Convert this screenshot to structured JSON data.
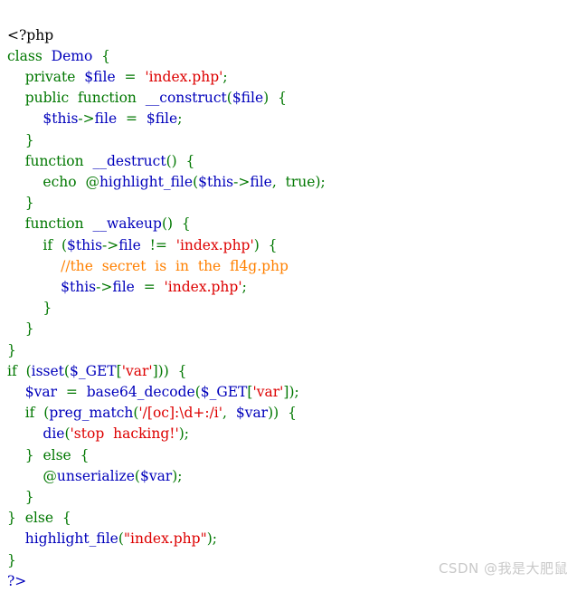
{
  "app": {
    "kind": "php-source-highlight",
    "background_color": "#ffffff"
  },
  "palette": {
    "html_tag": "#000000",
    "variable_or_function": "#0000BB",
    "keyword": "#007700",
    "string": "#DD0000",
    "comment": "#FF8000"
  },
  "watermark": {
    "text": "CSDN @我是大肥鼠",
    "color": "#c9c9c9"
  },
  "code": {
    "language": "php",
    "full_text": "<?php\nclass Demo  {\n    private  $file  =  'index.php';\n    public  function  __construct($file)  {\n        $this->file  =  $file;\n    }\n    function  __destruct()  {\n        echo  @highlight_file($this->file,  true);\n    }\n    function  __wakeup()  {\n        if  ($this->file  !=  'index.php')  {\n            //the  secret  is  in  the  fl4g.php\n            $this->file  =  'index.php';\n        }\n    }\n}\nif  (isset($_GET['var']))  {\n    $var  =  base64_decode($_GET['var']);\n    if  (preg_match('/[oc]:\\d+:/i',  $var))  {\n        die('stop  hacking!');\n    }  else  {\n        @unserialize($var);\n    }\n}  else  {\n    highlight_file(\"index.php\");\n}\n?>",
    "lines": [
      {
        "indent": 0,
        "tokens": [
          {
            "t": "html",
            "s": "<?php"
          }
        ]
      },
      {
        "indent": 0,
        "tokens": [
          {
            "t": "keyword",
            "s": "class"
          },
          {
            "t": "plain",
            "s": "  "
          },
          {
            "t": "default",
            "s": "Demo"
          },
          {
            "t": "plain",
            "s": "  "
          },
          {
            "t": "keyword",
            "s": "{"
          }
        ]
      },
      {
        "indent": 4,
        "tokens": [
          {
            "t": "keyword",
            "s": "private"
          },
          {
            "t": "plain",
            "s": "  "
          },
          {
            "t": "default",
            "s": "$file"
          },
          {
            "t": "plain",
            "s": "  "
          },
          {
            "t": "keyword",
            "s": "="
          },
          {
            "t": "plain",
            "s": "  "
          },
          {
            "t": "string",
            "s": "'index.php'"
          },
          {
            "t": "keyword",
            "s": ";"
          }
        ]
      },
      {
        "indent": 4,
        "tokens": [
          {
            "t": "keyword",
            "s": "public"
          },
          {
            "t": "plain",
            "s": "  "
          },
          {
            "t": "keyword",
            "s": "function"
          },
          {
            "t": "plain",
            "s": "  "
          },
          {
            "t": "default",
            "s": "__construct"
          },
          {
            "t": "keyword",
            "s": "("
          },
          {
            "t": "default",
            "s": "$file"
          },
          {
            "t": "keyword",
            "s": ")"
          },
          {
            "t": "plain",
            "s": "  "
          },
          {
            "t": "keyword",
            "s": "{"
          }
        ]
      },
      {
        "indent": 8,
        "tokens": [
          {
            "t": "default",
            "s": "$this"
          },
          {
            "t": "keyword",
            "s": "->"
          },
          {
            "t": "default",
            "s": "file"
          },
          {
            "t": "plain",
            "s": "  "
          },
          {
            "t": "keyword",
            "s": "="
          },
          {
            "t": "plain",
            "s": "  "
          },
          {
            "t": "default",
            "s": "$file"
          },
          {
            "t": "keyword",
            "s": ";"
          }
        ]
      },
      {
        "indent": 4,
        "tokens": [
          {
            "t": "keyword",
            "s": "}"
          }
        ]
      },
      {
        "indent": 4,
        "tokens": [
          {
            "t": "keyword",
            "s": "function"
          },
          {
            "t": "plain",
            "s": "  "
          },
          {
            "t": "default",
            "s": "__destruct"
          },
          {
            "t": "keyword",
            "s": "()"
          },
          {
            "t": "plain",
            "s": "  "
          },
          {
            "t": "keyword",
            "s": "{"
          }
        ]
      },
      {
        "indent": 8,
        "tokens": [
          {
            "t": "keyword",
            "s": "echo"
          },
          {
            "t": "plain",
            "s": "  "
          },
          {
            "t": "keyword",
            "s": "@"
          },
          {
            "t": "default",
            "s": "highlight_file"
          },
          {
            "t": "keyword",
            "s": "("
          },
          {
            "t": "default",
            "s": "$this"
          },
          {
            "t": "keyword",
            "s": "->"
          },
          {
            "t": "default",
            "s": "file"
          },
          {
            "t": "keyword",
            "s": ","
          },
          {
            "t": "plain",
            "s": "  "
          },
          {
            "t": "keyword",
            "s": "true"
          },
          {
            "t": "keyword",
            "s": ");"
          }
        ]
      },
      {
        "indent": 4,
        "tokens": [
          {
            "t": "keyword",
            "s": "}"
          }
        ]
      },
      {
        "indent": 4,
        "tokens": [
          {
            "t": "keyword",
            "s": "function"
          },
          {
            "t": "plain",
            "s": "  "
          },
          {
            "t": "default",
            "s": "__wakeup"
          },
          {
            "t": "keyword",
            "s": "()"
          },
          {
            "t": "plain",
            "s": "  "
          },
          {
            "t": "keyword",
            "s": "{"
          }
        ]
      },
      {
        "indent": 8,
        "tokens": [
          {
            "t": "keyword",
            "s": "if"
          },
          {
            "t": "plain",
            "s": "  "
          },
          {
            "t": "keyword",
            "s": "("
          },
          {
            "t": "default",
            "s": "$this"
          },
          {
            "t": "keyword",
            "s": "->"
          },
          {
            "t": "default",
            "s": "file"
          },
          {
            "t": "plain",
            "s": "  "
          },
          {
            "t": "keyword",
            "s": "!="
          },
          {
            "t": "plain",
            "s": "  "
          },
          {
            "t": "string",
            "s": "'index.php'"
          },
          {
            "t": "keyword",
            "s": ")"
          },
          {
            "t": "plain",
            "s": "  "
          },
          {
            "t": "keyword",
            "s": "{"
          }
        ]
      },
      {
        "indent": 12,
        "tokens": [
          {
            "t": "comment",
            "s": "//the  secret  is  in  the  fl4g.php"
          }
        ]
      },
      {
        "indent": 12,
        "tokens": [
          {
            "t": "default",
            "s": "$this"
          },
          {
            "t": "keyword",
            "s": "->"
          },
          {
            "t": "default",
            "s": "file"
          },
          {
            "t": "plain",
            "s": "  "
          },
          {
            "t": "keyword",
            "s": "="
          },
          {
            "t": "plain",
            "s": "  "
          },
          {
            "t": "string",
            "s": "'index.php'"
          },
          {
            "t": "keyword",
            "s": ";"
          }
        ]
      },
      {
        "indent": 8,
        "tokens": [
          {
            "t": "keyword",
            "s": "}"
          }
        ]
      },
      {
        "indent": 4,
        "tokens": [
          {
            "t": "keyword",
            "s": "}"
          }
        ]
      },
      {
        "indent": 0,
        "tokens": [
          {
            "t": "keyword",
            "s": "}"
          }
        ]
      },
      {
        "indent": 0,
        "tokens": [
          {
            "t": "keyword",
            "s": "if"
          },
          {
            "t": "plain",
            "s": "  "
          },
          {
            "t": "keyword",
            "s": "("
          },
          {
            "t": "default",
            "s": "isset"
          },
          {
            "t": "keyword",
            "s": "("
          },
          {
            "t": "default",
            "s": "$_GET"
          },
          {
            "t": "keyword",
            "s": "["
          },
          {
            "t": "string",
            "s": "'var'"
          },
          {
            "t": "keyword",
            "s": "]))"
          },
          {
            "t": "plain",
            "s": "  "
          },
          {
            "t": "keyword",
            "s": "{"
          }
        ]
      },
      {
        "indent": 4,
        "tokens": [
          {
            "t": "default",
            "s": "$var"
          },
          {
            "t": "plain",
            "s": "  "
          },
          {
            "t": "keyword",
            "s": "="
          },
          {
            "t": "plain",
            "s": "  "
          },
          {
            "t": "default",
            "s": "base64_decode"
          },
          {
            "t": "keyword",
            "s": "("
          },
          {
            "t": "default",
            "s": "$_GET"
          },
          {
            "t": "keyword",
            "s": "["
          },
          {
            "t": "string",
            "s": "'var'"
          },
          {
            "t": "keyword",
            "s": "]);"
          }
        ]
      },
      {
        "indent": 4,
        "tokens": [
          {
            "t": "keyword",
            "s": "if"
          },
          {
            "t": "plain",
            "s": "  "
          },
          {
            "t": "keyword",
            "s": "("
          },
          {
            "t": "default",
            "s": "preg_match"
          },
          {
            "t": "keyword",
            "s": "("
          },
          {
            "t": "string",
            "s": "'/[oc]:\\d+:/i'"
          },
          {
            "t": "keyword",
            "s": ","
          },
          {
            "t": "plain",
            "s": "  "
          },
          {
            "t": "default",
            "s": "$var"
          },
          {
            "t": "keyword",
            "s": "))"
          },
          {
            "t": "plain",
            "s": "  "
          },
          {
            "t": "keyword",
            "s": "{"
          }
        ]
      },
      {
        "indent": 8,
        "tokens": [
          {
            "t": "default",
            "s": "die"
          },
          {
            "t": "keyword",
            "s": "("
          },
          {
            "t": "string",
            "s": "'stop  hacking!'"
          },
          {
            "t": "keyword",
            "s": ");"
          }
        ]
      },
      {
        "indent": 4,
        "tokens": [
          {
            "t": "keyword",
            "s": "}"
          },
          {
            "t": "plain",
            "s": "  "
          },
          {
            "t": "keyword",
            "s": "else"
          },
          {
            "t": "plain",
            "s": "  "
          },
          {
            "t": "keyword",
            "s": "{"
          }
        ]
      },
      {
        "indent": 8,
        "tokens": [
          {
            "t": "keyword",
            "s": "@"
          },
          {
            "t": "default",
            "s": "unserialize"
          },
          {
            "t": "keyword",
            "s": "("
          },
          {
            "t": "default",
            "s": "$var"
          },
          {
            "t": "keyword",
            "s": ");"
          }
        ]
      },
      {
        "indent": 4,
        "tokens": [
          {
            "t": "keyword",
            "s": "}"
          }
        ]
      },
      {
        "indent": 0,
        "tokens": [
          {
            "t": "keyword",
            "s": "}"
          },
          {
            "t": "plain",
            "s": "  "
          },
          {
            "t": "keyword",
            "s": "else"
          },
          {
            "t": "plain",
            "s": "  "
          },
          {
            "t": "keyword",
            "s": "{"
          }
        ]
      },
      {
        "indent": 4,
        "tokens": [
          {
            "t": "default",
            "s": "highlight_file"
          },
          {
            "t": "keyword",
            "s": "("
          },
          {
            "t": "string",
            "s": "\"index.php\""
          },
          {
            "t": "keyword",
            "s": ");"
          }
        ]
      },
      {
        "indent": 0,
        "tokens": [
          {
            "t": "keyword",
            "s": "}"
          }
        ]
      },
      {
        "indent": 0,
        "tokens": [
          {
            "t": "default",
            "s": "?>"
          }
        ]
      }
    ]
  }
}
